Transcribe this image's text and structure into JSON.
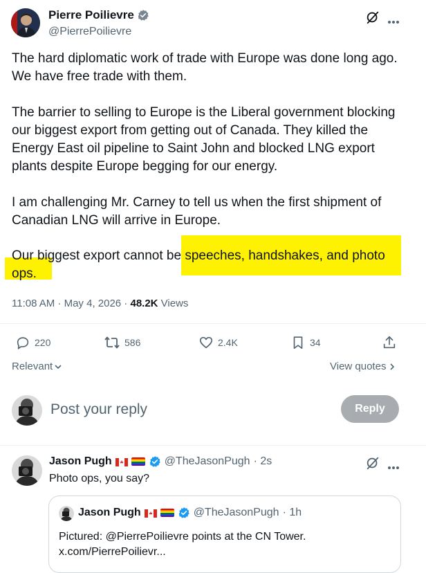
{
  "post": {
    "author_name": "Pierre Poilievre",
    "author_handle": "@PierrePoilievre",
    "paragraph1": "The hard diplomatic work of trade with Europe was done long ago. We have free trade with them.",
    "paragraph2": "The barrier to selling to Europe is the Liberal government blocking our biggest export from getting out of Canada. They killed the Energy East oil pipeline to Saint John and blocked LNG export plants despite Europe begging for our energy.",
    "paragraph3": "I am challenging Mr. Carney to tell us when the first shipment of Canadian LNG will arrive in Europe.",
    "p4_line1_plain": "Our biggest export cannot be",
    "p4_line1_highlight": " speeches, handshakes, and photo",
    "p4_line2_highlight": "ops.",
    "timestamp": "11:08 AM · May 4, 2026 · ",
    "views_count": "48.2K",
    "views_label": " Views"
  },
  "actions": {
    "replies": "220",
    "reposts": "586",
    "likes": "2.4K",
    "bookmarks": "34"
  },
  "sort": {
    "label": "Relevant",
    "view_quotes": "View quotes"
  },
  "composer": {
    "placeholder": "Post your reply",
    "button": "Reply"
  },
  "reply": {
    "author_name": "Jason Pugh",
    "author_handle": "@TheJasonPugh",
    "time": " · 2s",
    "text": "Photo ops, you say?"
  },
  "quoted": {
    "author_name": "Jason Pugh",
    "author_handle": "@TheJasonPugh",
    "time": " · 1h",
    "line1": "Pictured: @PierrePoilievre points at the CN Tower.",
    "line2": "x.com/PierrePoilievr..."
  },
  "colors": {
    "highlight": "#fff200",
    "verified": "#1d9bf0",
    "reply_button": "#8b9196"
  }
}
